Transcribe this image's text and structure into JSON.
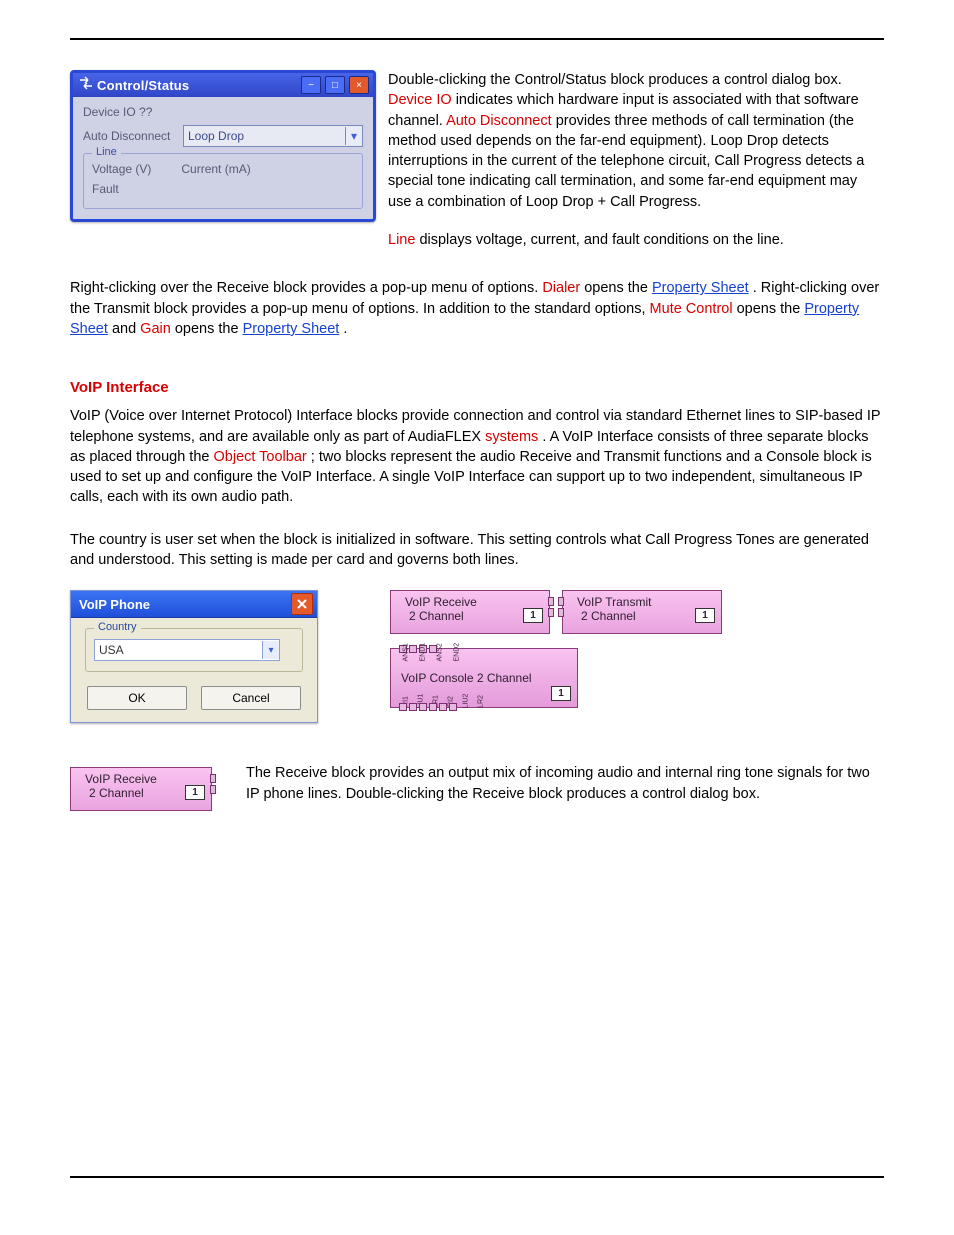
{
  "controlStatus": {
    "title": "Control/Status",
    "deviceIoLabel": "Device IO  ??",
    "autoDisconnectLabel": "Auto Disconnect",
    "autoDisconnectValue": "Loop Drop",
    "lineGroup": "Line",
    "voltageLabel": "Voltage (V)",
    "currentLabel": "Current (mA)",
    "faultLabel": "Fault"
  },
  "para1": {
    "a": "Double-clicking the Control/Status block produces a control dialog box.  ",
    "bRed": "Device IO",
    "c": " indicates which hardware input is associated with that software channel.  ",
    "dRed": "Auto Disconnect",
    "e": " provides three methods of call termination (the method used depends on the far-end equipment). Loop Drop detects interruptions in the current of the telephone circuit, Call Progress detects a special tone indicating call termination, and some far-end equipment may use a combination of Loop Drop + Call Progress."
  },
  "para2": {
    "aRed": "Line",
    "b": " displays voltage, current, and fault conditions on the line."
  },
  "midLinks": {
    "l1a": "Right-clicking over the Receive block provides a pop-up menu of options.  ",
    "l1bRed": "Dialer",
    "l1c": " opens the ",
    "l1dLink": "Property Sheet",
    "l1e": ".  Right-clicking over the Transmit block provides a pop-up menu of options.  In addition to the standard options, ",
    "l1fRed": "Mute Control",
    "l1g": " opens the ",
    "l1hLink": "Property Sheet",
    "l1i": " and ",
    "l1jRed": "Gain",
    "l1k": " opens the ",
    "l1lLink": "Property Sheet",
    "l1m": "."
  },
  "voipTitle": "VoIP Interface",
  "voipPara": {
    "a": "VoIP (Voice over Internet Protocol) Interface blocks provide connection and control via standard Ethernet lines to SIP-based IP telephone systems, and are available only as part of AudiaFLEX ",
    "bRed": "systems",
    "c": ".  A VoIP Interface consists of three separate blocks as placed through the ",
    "dRed": "Object Toolbar",
    "e": "; two blocks represent the audio Receive and Transmit functions and a Console block is used to set up and configure the VoIP Interface.  A single VoIP Interface can support up to two independent, simultaneous IP calls, each with its own audio path."
  },
  "countryPara": "The country is user set when the block is initialized in software.  This setting controls what Call Progress Tones are generated and understood.  This setting is made per card and governs both lines.",
  "voipDialog": {
    "title": "VoIP Phone",
    "countryGroup": "Country",
    "countryValue": "USA",
    "ok": "OK",
    "cancel": "Cancel"
  },
  "blocks": {
    "rxTitle": "VoIP Receive",
    "rxSub": "2 Channel",
    "txTitle": "VoIP Transmit",
    "txSub": "2 Channel",
    "consoleTitle": "VoIP Console 2 Channel",
    "one": "1",
    "topLabels": [
      "ANS1",
      "END1",
      "ANS2",
      "END2"
    ],
    "bottomLabels": [
      "RI1",
      "LIU1",
      "LR1",
      "RI2",
      "LIU2",
      "LR2"
    ]
  },
  "rxPara": "The Receive block provides an output mix of incoming audio and internal ring tone signals for two IP phone lines.  Double-clicking the Receive block produces a control dialog box."
}
